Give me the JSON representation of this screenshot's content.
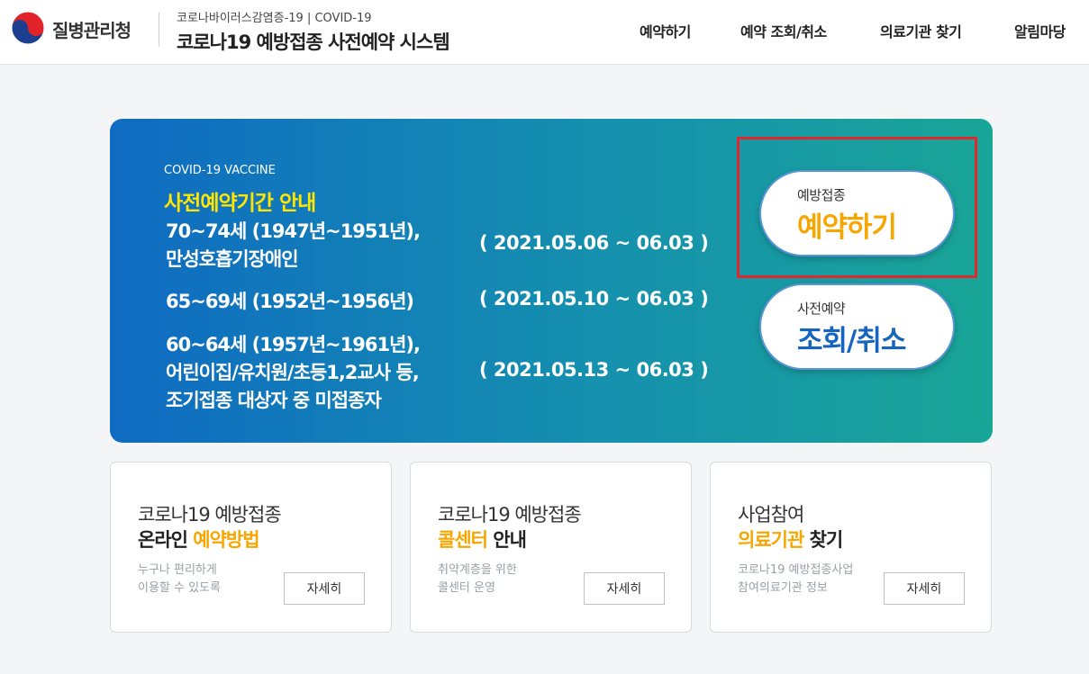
{
  "header": {
    "logo_text": "질병관리청",
    "sub_title": "코로나바이러스감염증-19 | COVID-19",
    "main_title": "코로나19 예방접종 사전예약 시스템",
    "nav": [
      "예약하기",
      "예약 조회/취소",
      "의료기관 찾기",
      "알림마당"
    ]
  },
  "banner": {
    "label": "COVID-19 VACCINE",
    "title": "사전예약기간 안내",
    "groups": [
      {
        "lines": [
          "70~74세 (1947년~1951년),",
          "만성호흡기장애인"
        ],
        "period": "( 2021.05.06 ~ 06.03 )"
      },
      {
        "lines": [
          "65~69세 (1952년~1956년)"
        ],
        "period": "( 2021.05.10 ~ 06.03 )"
      },
      {
        "lines": [
          "60~64세 (1957년~1961년),",
          "어린이집/유치원/초등1,2교사 등,",
          "조기접종 대상자 중 미접종자"
        ],
        "period": "( 2021.05.13 ~ 06.03 )"
      }
    ],
    "reserve": {
      "small": "예방접종",
      "big": "예약하기"
    },
    "lookup": {
      "small": "사전예약",
      "big": "조회/취소"
    },
    "highlight_color": "#e1262c"
  },
  "cards": [
    {
      "line1": "코로나19 예방접종",
      "line2_highlight": "예약방법",
      "line2_dark_prefix": "온라인 ",
      "line2_dark_suffix": "",
      "desc": [
        "누구나 편리하게",
        "이용할 수 있도록"
      ],
      "button": "자세히"
    },
    {
      "line1": "코로나19 예방접종",
      "line2_highlight": "콜센터",
      "line2_dark_prefix": "",
      "line2_dark_suffix": " 안내",
      "desc": [
        "취약계층을 위한",
        "콜센터 운영"
      ],
      "button": "자세히"
    },
    {
      "line1": "사업참여",
      "line2_highlight": "의료기관",
      "line2_dark_prefix": "",
      "line2_dark_suffix": " 찾기",
      "desc": [
        "코로나19 예방접종사업",
        "참여의료기관 정보"
      ],
      "button": "자세히"
    }
  ],
  "colors": {
    "accent": "#f7a600",
    "primary": "#1565c0",
    "banner_left": "#0f6bc2",
    "banner_right": "#19a597"
  }
}
